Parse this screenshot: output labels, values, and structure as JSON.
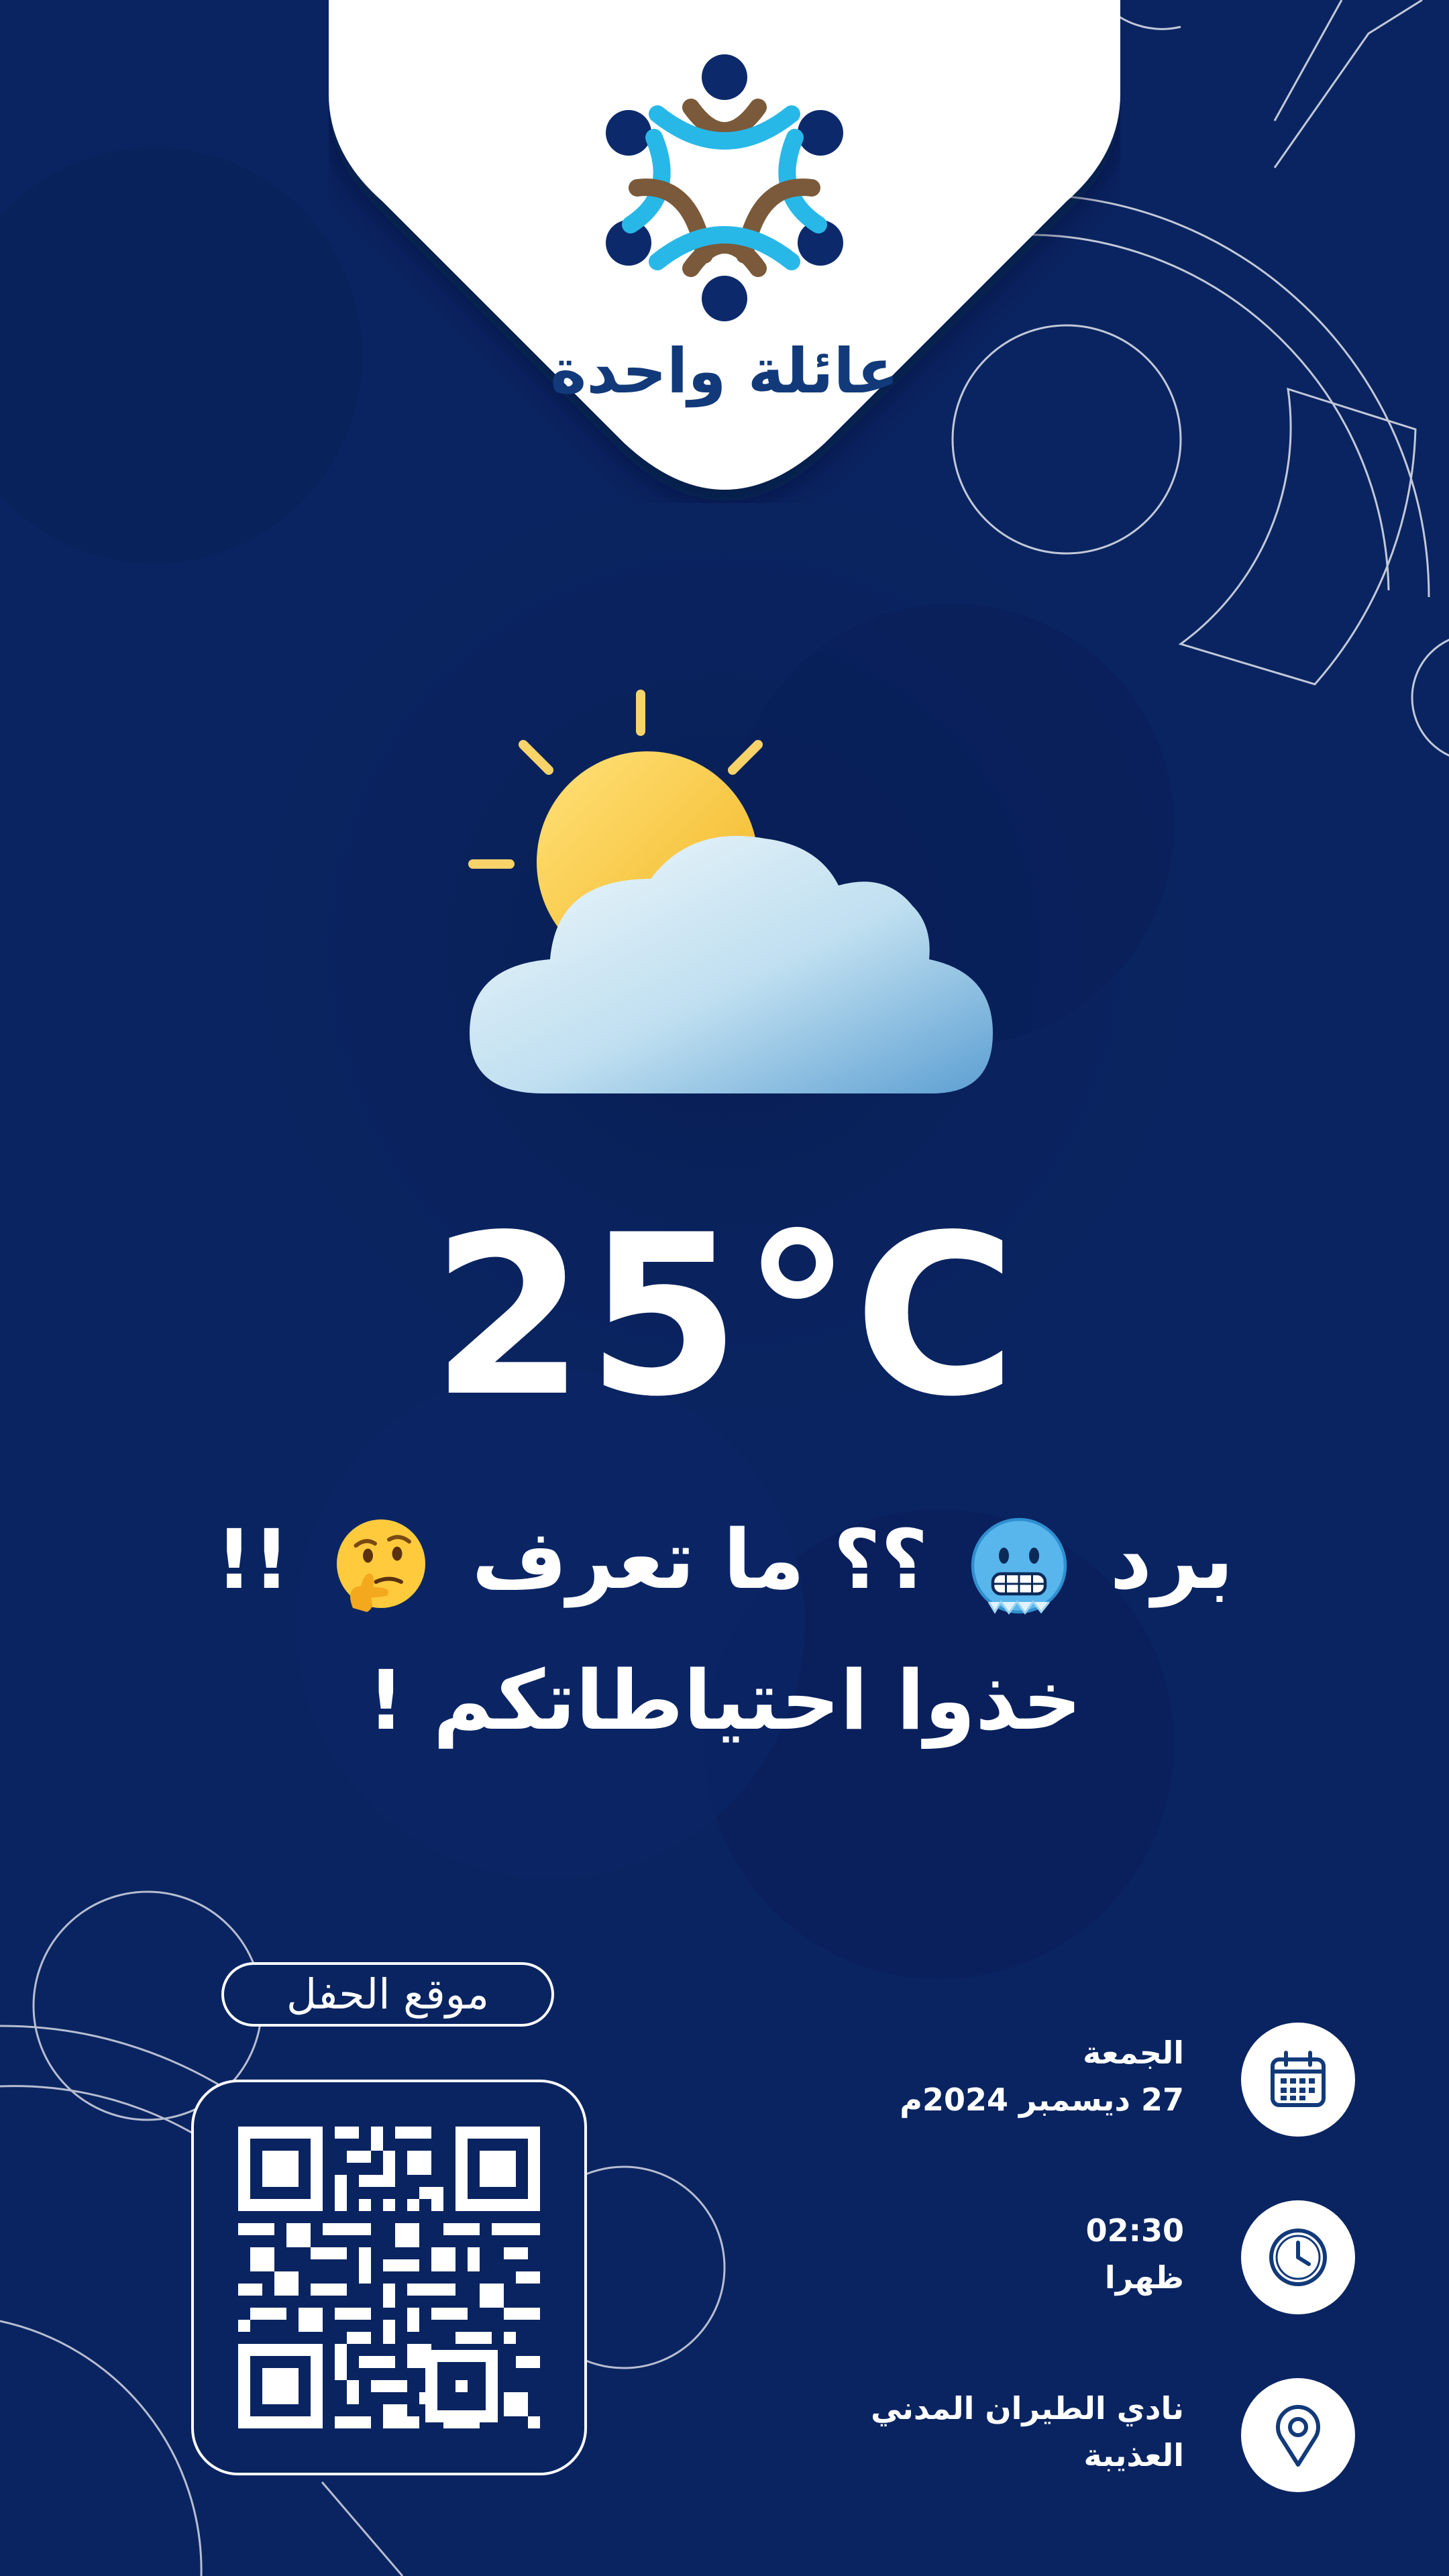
{
  "brand": {
    "logo_text": "عائلة واحدة"
  },
  "weather": {
    "icon": "sun-behind-cloud-icon",
    "temperature": "25°C"
  },
  "message": {
    "line1_part1": "برد",
    "line1_emoji1": "freezing-face-emoji",
    "line1_part2": "؟؟ ما تعرف",
    "line1_emoji2": "thinking-face-emoji",
    "line1_part3": "!!",
    "line2": "خذوا احتياطاتكم !"
  },
  "location_qr": {
    "label": "موقع الحفل"
  },
  "details": {
    "date_day": "الجمعة",
    "date_full": "27 ديسمبر 2024م",
    "time_value": "02:30",
    "time_period": "ظهرا",
    "venue_name": "نادي الطيران المدني",
    "venue_area": "العذيبة"
  },
  "colors": {
    "background": "#0a2461",
    "accent_cyan": "#27b8e8",
    "accent_brown": "#7a5a3a",
    "logo_navy": "#123a7a"
  }
}
